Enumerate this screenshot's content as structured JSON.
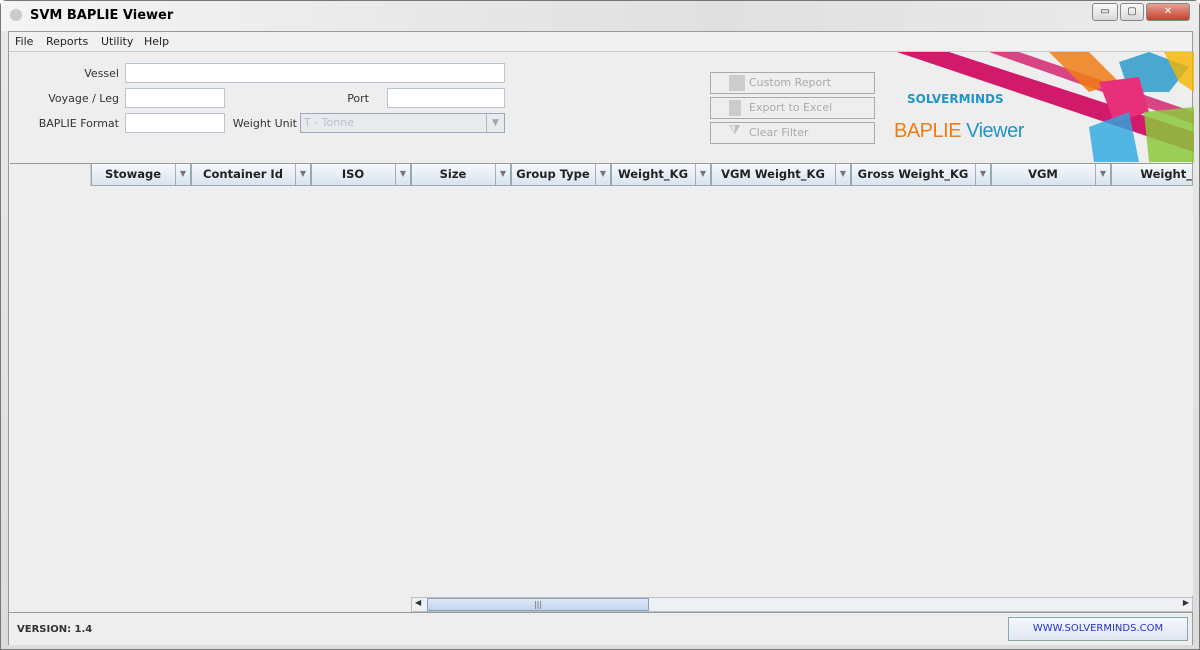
{
  "window": {
    "title": "SVM  BAPLIE Viewer",
    "minimize": "▭",
    "restore": "▢",
    "close": "✕"
  },
  "menu": [
    "File",
    "Reports",
    "Utility",
    "Help"
  ],
  "form": {
    "vessel_label": "Vessel",
    "vessel_value": "",
    "voyage_label": "Voyage / Leg",
    "voyage_value": "",
    "port_label": "Port",
    "port_value": "",
    "format_label": "BAPLIE Format",
    "format_value": "",
    "weight_unit_label": "Weight Unit",
    "weight_unit_value": "T - Tonne"
  },
  "buttons": {
    "custom_report": "Custom Report",
    "export_excel": "Export to Excel",
    "clear_filter": "Clear Filter"
  },
  "logo": {
    "company": "SOLVERMINDS",
    "product_part1": "BAPLIE",
    "product_part2": "Viewer",
    "colors": {
      "orange": "#f07d14",
      "blue": "#1f95c8",
      "magenta": "#d11a6a"
    }
  },
  "table": {
    "columns": [
      "",
      "Stowage",
      "Container Id",
      "ISO",
      "Size",
      "Group Type",
      "Weight_KG",
      "VGM Weight_KG",
      "Gross Weight_KG",
      "VGM",
      "Weight_"
    ],
    "rows": []
  },
  "status": {
    "version": "VERSION: 1.4",
    "website": "WWW.SOLVERMINDS.COM"
  }
}
